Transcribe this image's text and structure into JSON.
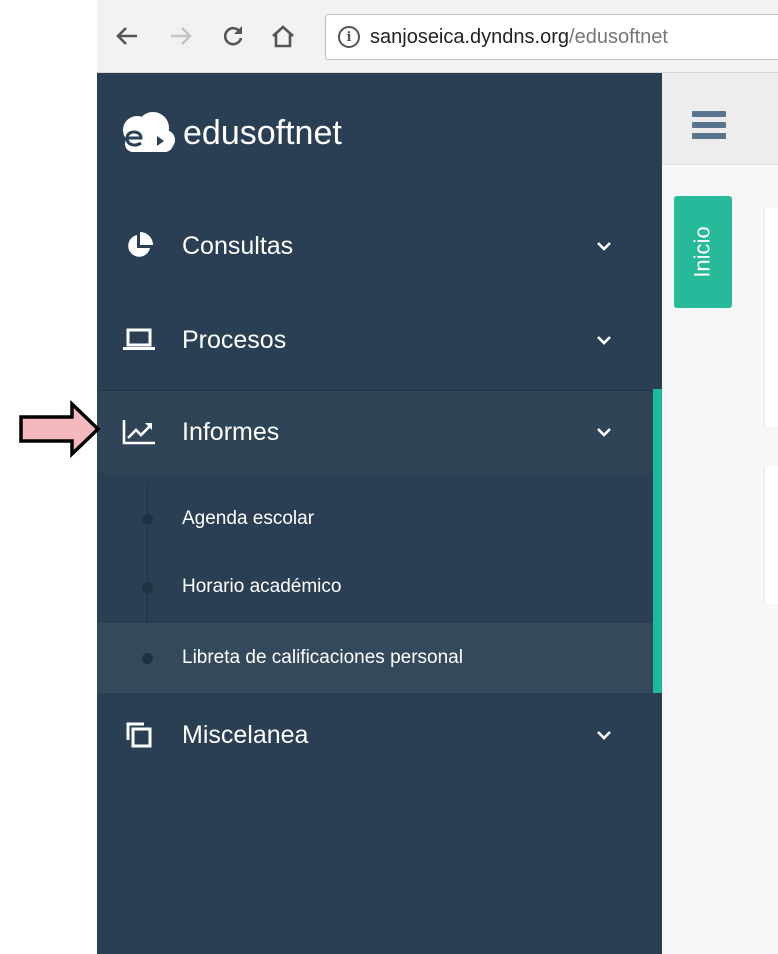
{
  "browser": {
    "back_icon": "arrow-left-icon",
    "forward_icon": "arrow-right-icon",
    "reload_icon": "reload-icon",
    "home_icon": "home-icon",
    "info_glyph": "i",
    "url_domain": "sanjoseica.dyndns.org",
    "url_path": "/edusoftnet"
  },
  "sidebar": {
    "brand": "edusoftnet",
    "items": [
      {
        "label": "Consultas",
        "icon": "pie-chart-icon"
      },
      {
        "label": "Procesos",
        "icon": "laptop-icon"
      },
      {
        "label": "Informes",
        "icon": "line-chart-icon"
      },
      {
        "label": "Miscelanea",
        "icon": "clone-icon"
      }
    ],
    "submenu": [
      {
        "label": "Agenda escolar"
      },
      {
        "label": "Horario académico"
      },
      {
        "label": "Libreta de calificaciones personal"
      }
    ]
  },
  "content": {
    "tab_label": "Inicio"
  },
  "colors": {
    "sidebar_bg": "#2a3f54",
    "accent": "#1abb9c",
    "tab_green": "#26b99a",
    "annotation_arrow": "#f4b9bd"
  }
}
